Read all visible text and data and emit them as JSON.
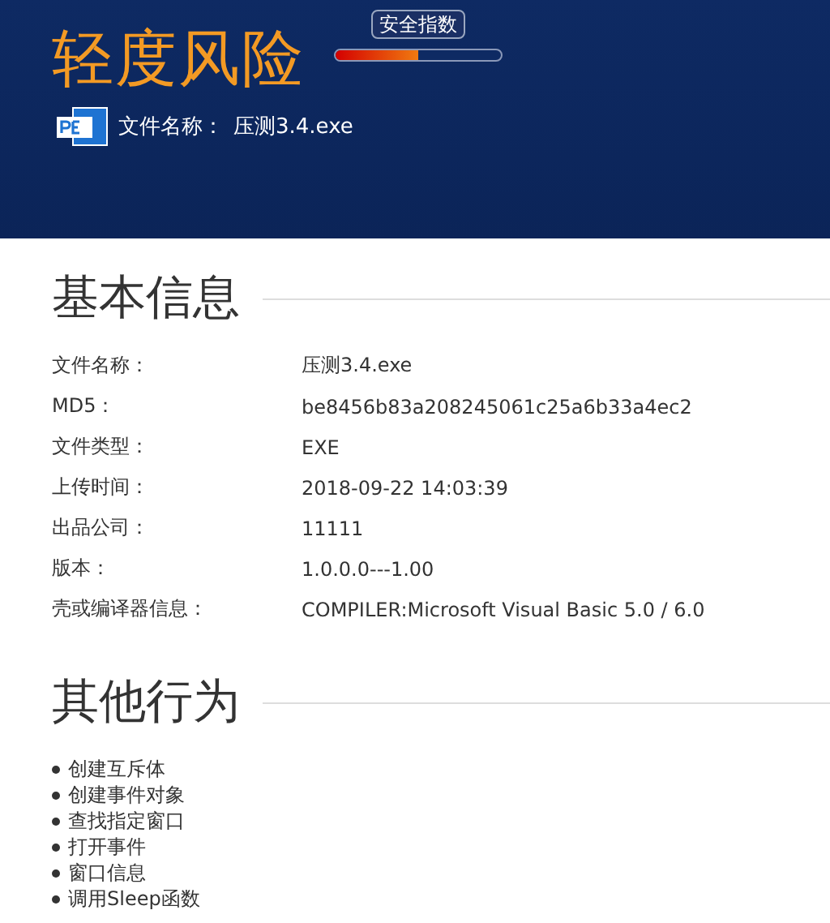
{
  "header": {
    "risk_level": "轻度风险",
    "safety_index": {
      "label": "安全指数",
      "level": 0.5
    },
    "file_name": {
      "label": "文件名称：",
      "value": "压测3.4.exe"
    }
  },
  "basic_info": {
    "title": "基本信息",
    "rows": [
      {
        "label": "文件名称：",
        "value": "压测3.4.exe"
      },
      {
        "label": "MD5：",
        "value": "be8456b83a208245061c25a6b33a4ec2"
      },
      {
        "label": "文件类型：",
        "value": "EXE"
      },
      {
        "label": "上传时间：",
        "value": "2018-09-22 14:03:39"
      },
      {
        "label": "出品公司：",
        "value": "11111"
      },
      {
        "label": "版本：",
        "value": "1.0.0.0---1.00"
      },
      {
        "label": "壳或编译器信息：",
        "value": "COMPILER:Microsoft Visual Basic 5.0 / 6.0"
      }
    ]
  },
  "other_behaviors": {
    "title": "其他行为",
    "items": [
      "创建互斥体",
      "创建事件对象",
      "查找指定窗口",
      "打开事件",
      "窗口信息",
      "调用Sleep函数"
    ]
  }
}
